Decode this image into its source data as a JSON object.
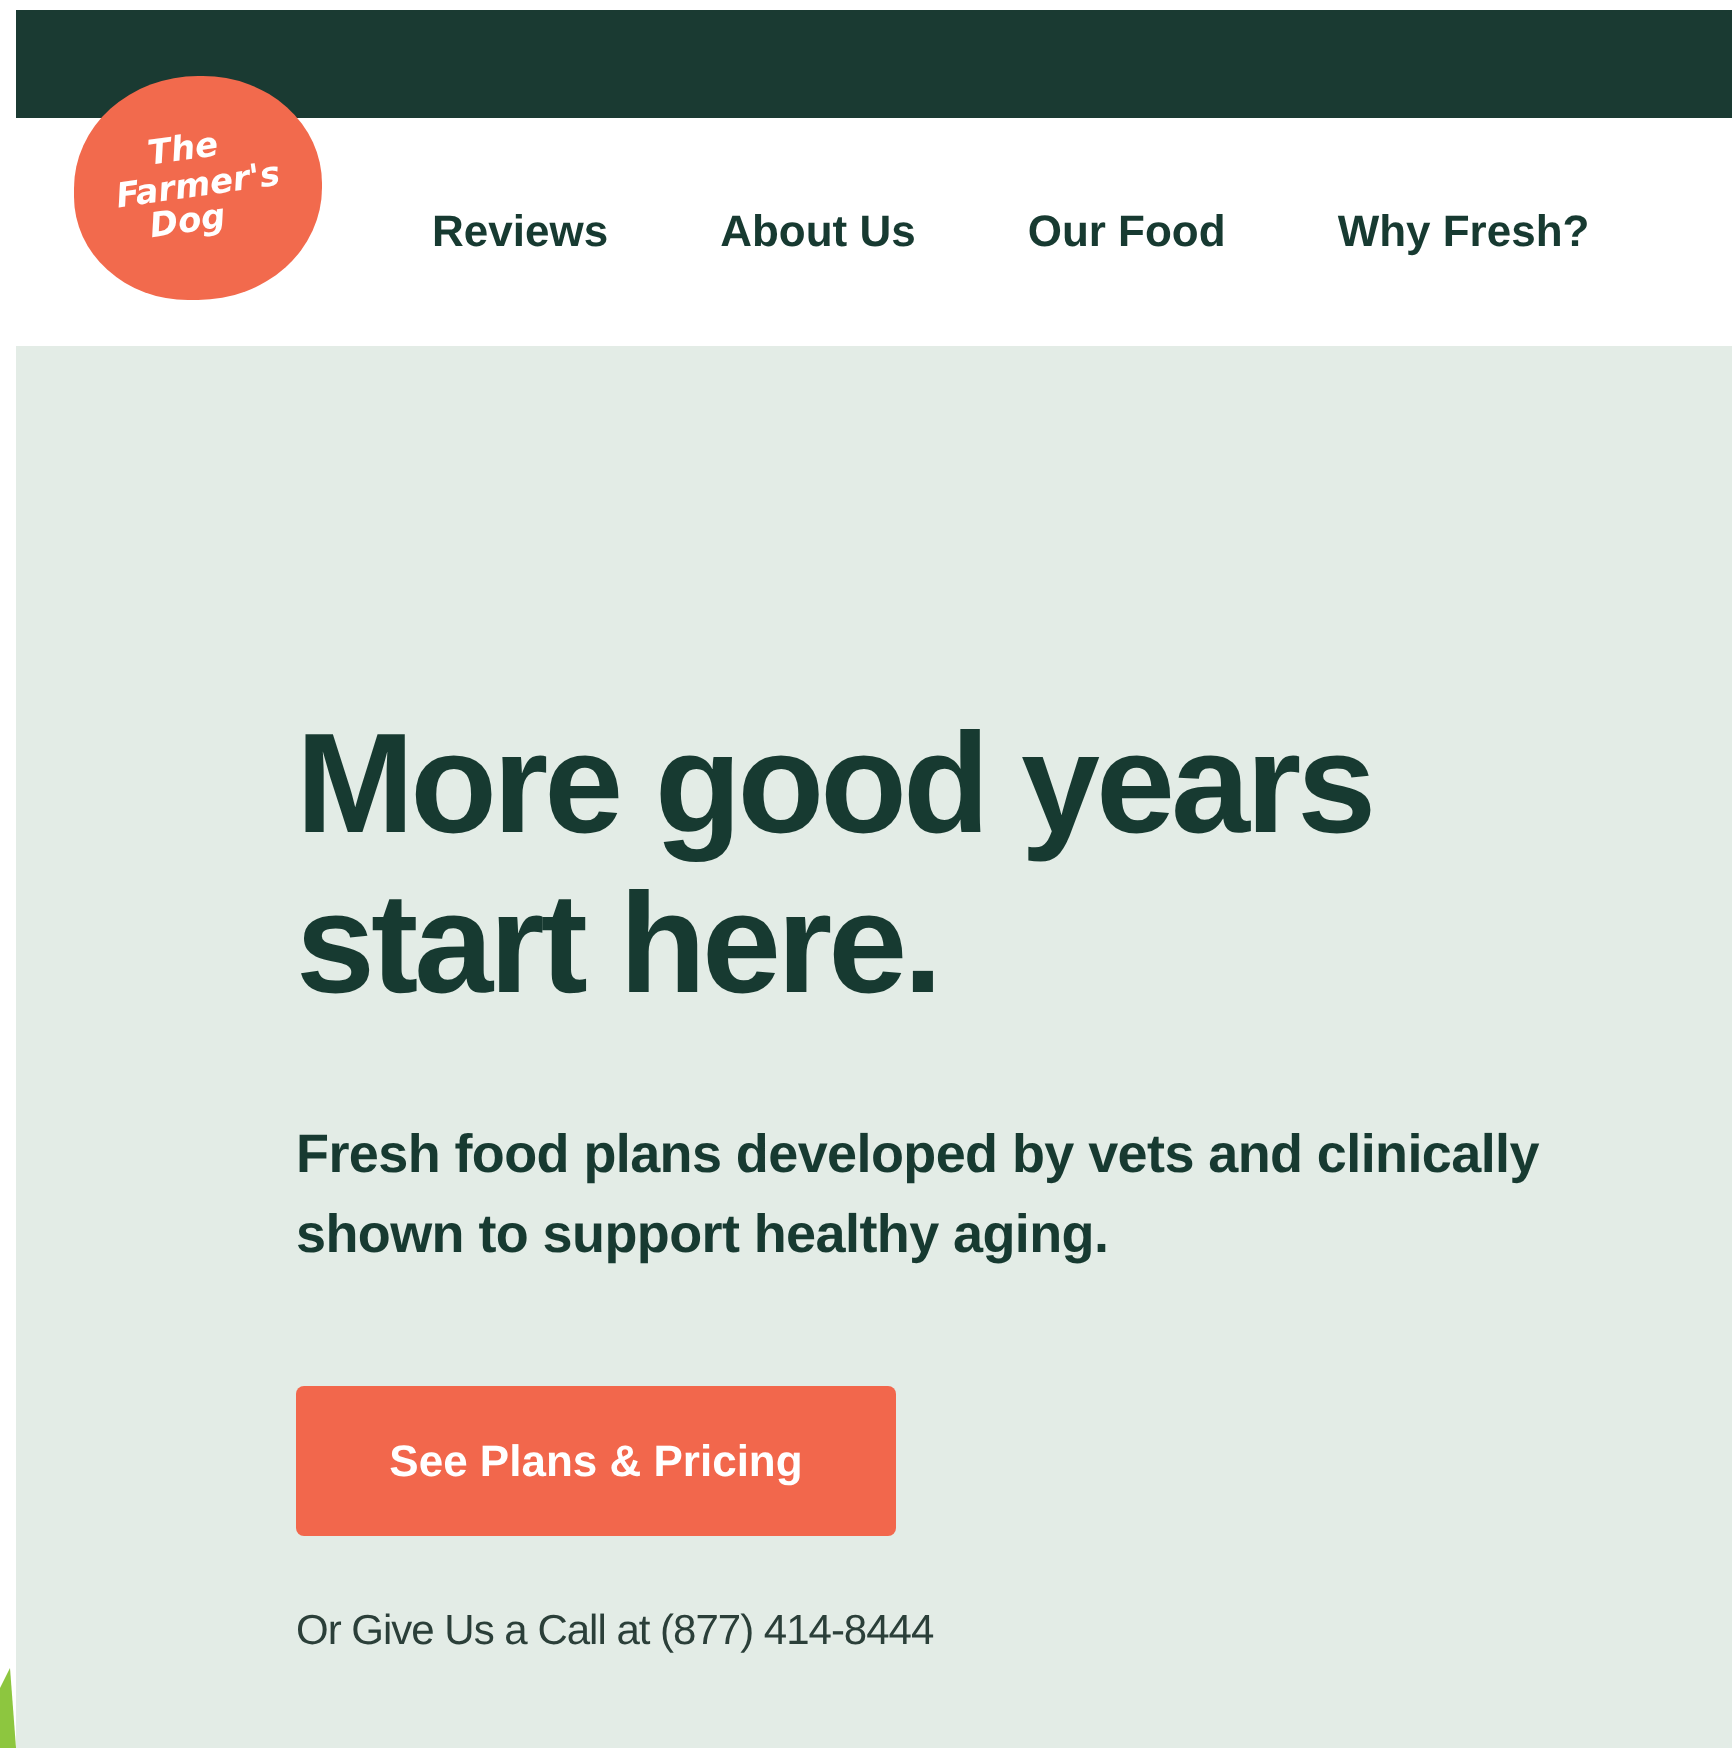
{
  "logo": {
    "lines": [
      "The",
      "Farmer's",
      "Dog"
    ]
  },
  "nav": [
    {
      "label": "Reviews"
    },
    {
      "label": "About Us"
    },
    {
      "label": "Our Food"
    },
    {
      "label": "Why Fresh?"
    }
  ],
  "hero": {
    "headline": [
      "More good years",
      "start here."
    ],
    "subheadline": "Fresh food plans developed by vets and clinically shown to support healthy aging.",
    "button": "See Plans & Pricing",
    "phone": "Or Give Us a Call at (877) 414-8444"
  }
}
